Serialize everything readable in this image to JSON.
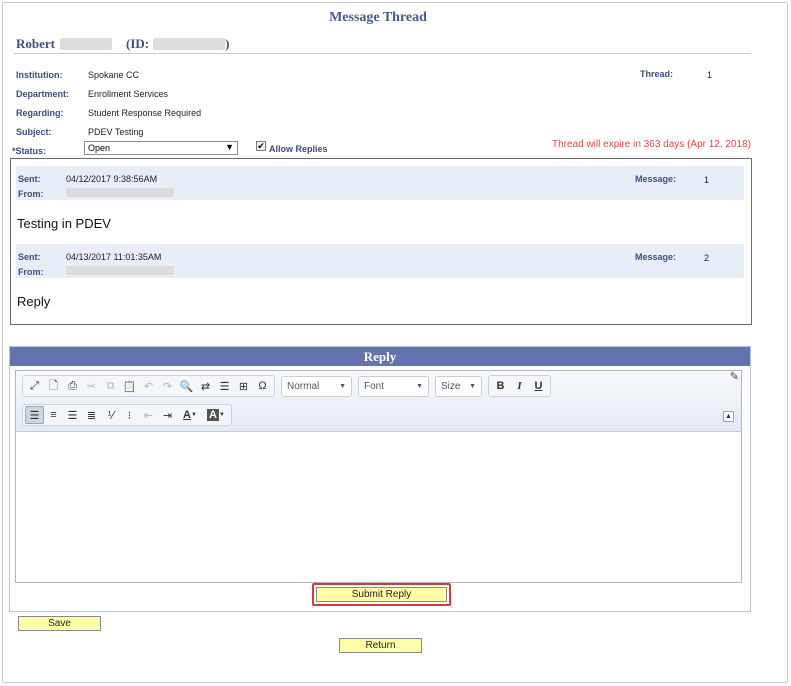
{
  "page": {
    "title": "Message Thread",
    "student_label": "Robert",
    "id_label": "(ID:",
    "id_close": ")"
  },
  "info": {
    "institution_label": "Institution:",
    "institution_value": "Spokane CC",
    "department_label": "Department:",
    "department_value": "Enrollment Services",
    "regarding_label": "Regarding:",
    "regarding_value": "Student Response Required",
    "subject_label": "Subject:",
    "subject_value": "PDEV Testing",
    "status_required": "*",
    "status_label": "Status:",
    "status_value": "Open",
    "allow_replies_label": "Allow Replies",
    "allow_replies_checked": true,
    "thread_label": "Thread:",
    "thread_value": "1",
    "expire_text": "Thread will expire in 363 days (Apr 12, 2018)"
  },
  "messages": [
    {
      "sent_label": "Sent:",
      "sent_value": "04/12/2017  9:38:56AM",
      "from_label": "From:",
      "message_label": "Message:",
      "message_number": "1",
      "body": "Testing in PDEV"
    },
    {
      "sent_label": "Sent:",
      "sent_value": "04/13/2017 11:01:35AM",
      "from_label": "From:",
      "message_label": "Message:",
      "message_number": "2",
      "body": "Reply"
    }
  ],
  "reply": {
    "header": "Reply",
    "format_combo": "Normal",
    "font_combo": "Font",
    "size_combo": "Size",
    "bold": "B",
    "italic": "I",
    "underline": "U",
    "font_color": "A",
    "bg_color": "A"
  },
  "buttons": {
    "submit_reply": "Submit Reply",
    "save": "Save",
    "return": "Return"
  },
  "colors": {
    "heading": "#4a5a8c",
    "reply_header": "#6573ad",
    "expire_text": "#d84848",
    "button_yellow": "#ffffa8",
    "highlight_border": "#d23c3c"
  }
}
